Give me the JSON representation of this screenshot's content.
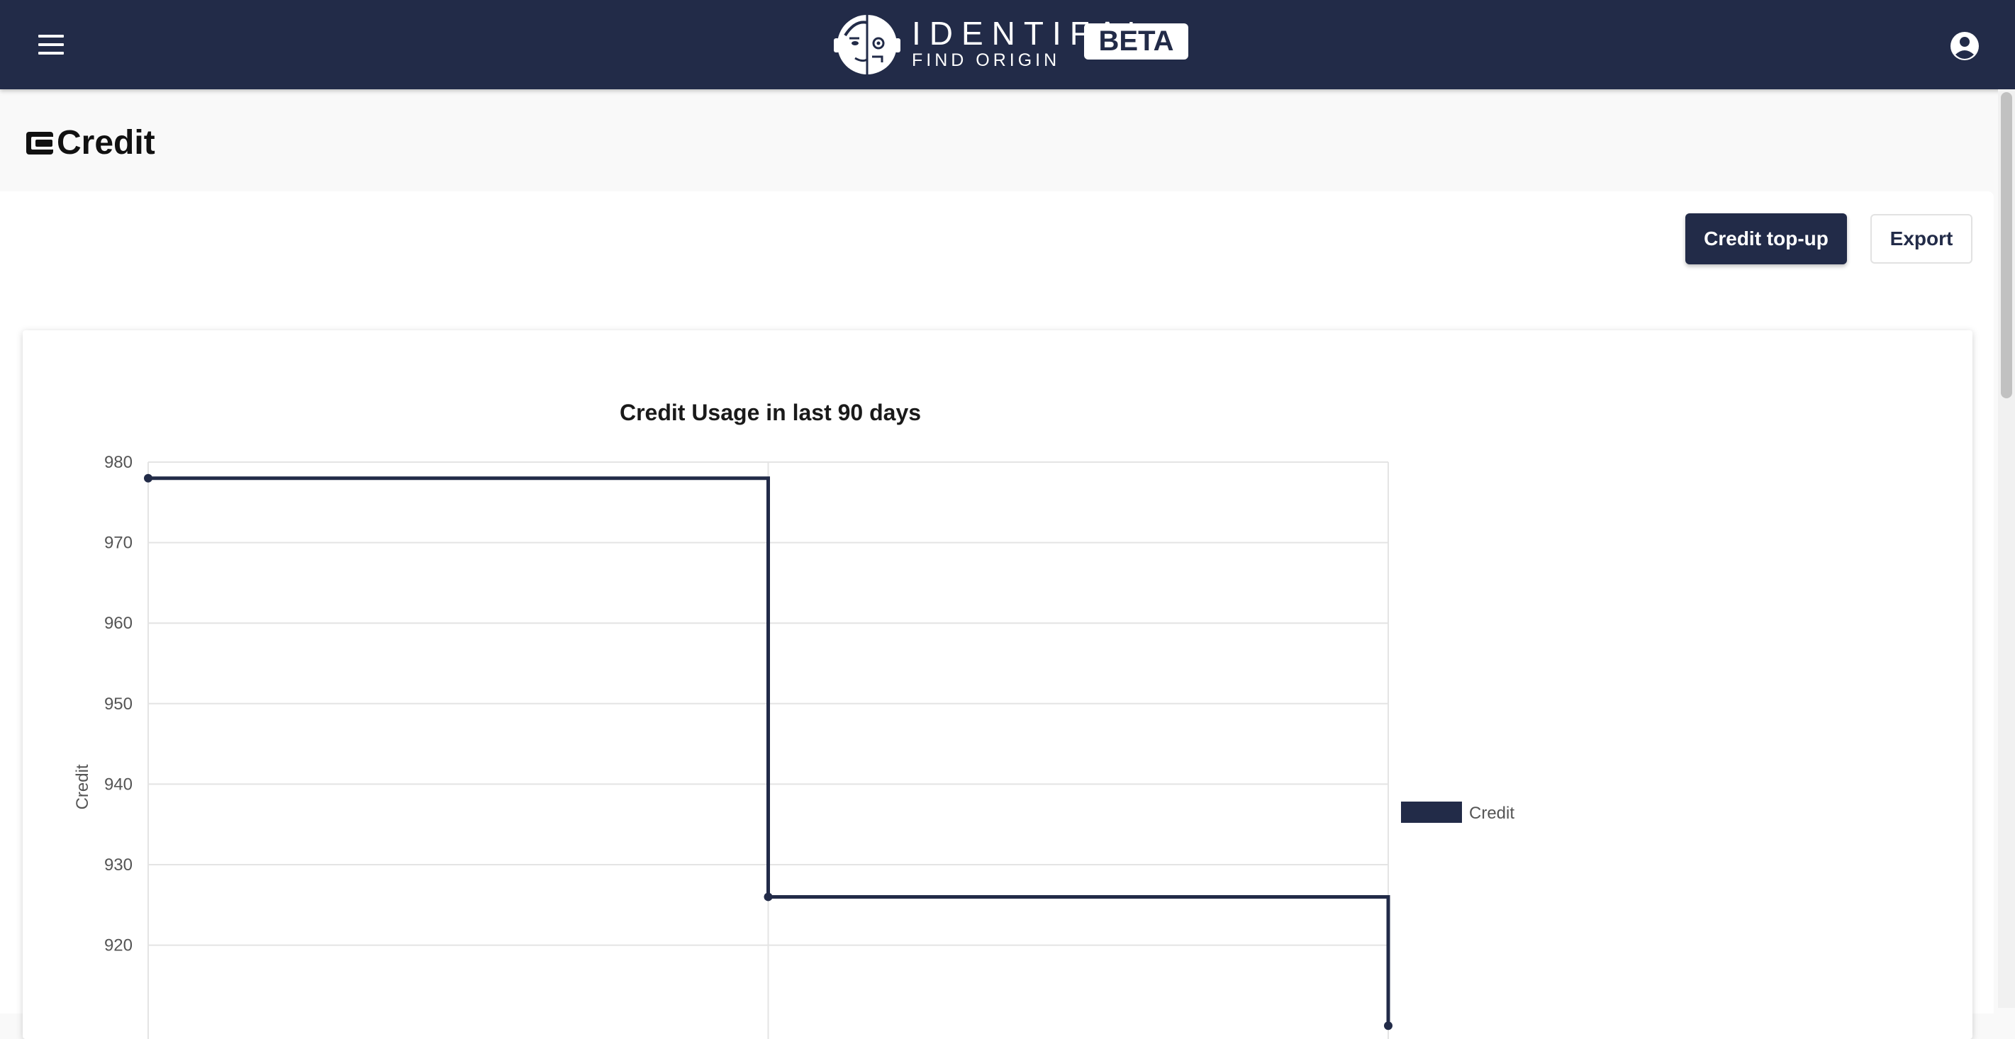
{
  "header": {
    "brand_name": "IDENTIFAI",
    "brand_tagline": "FIND ORIGIN",
    "badge": "BETA",
    "menu_icon": "hamburger-menu-icon",
    "account_icon": "account-circle-icon",
    "colors": {
      "navbar": "#222b48",
      "text": "#ffffff"
    }
  },
  "page": {
    "title": "Credit",
    "title_icon": "wallet-icon"
  },
  "actions": {
    "topup_label": "Credit top-up",
    "export_label": "Export"
  },
  "chart_data": {
    "type": "line",
    "stepped": true,
    "title": "Credit Usage in last 90 days",
    "xlabel": "",
    "ylabel": "Credit",
    "ylim": [
      910,
      980
    ],
    "yticks": [
      980,
      970,
      960,
      950,
      940,
      930,
      920
    ],
    "grid": true,
    "legend_position": "right",
    "series": [
      {
        "name": "Credit",
        "color": "#222b48",
        "points": [
          {
            "x": 0,
            "y": 978
          },
          {
            "x": 1,
            "y": 926
          },
          {
            "x": 2,
            "y": 910
          }
        ]
      }
    ]
  }
}
